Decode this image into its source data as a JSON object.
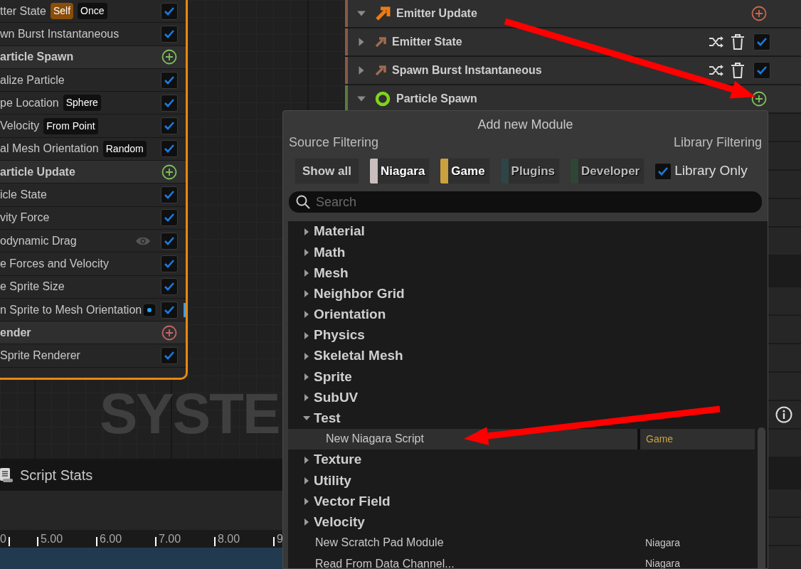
{
  "graph_node": {
    "rows": [
      {
        "kind": "module",
        "label": "tter State",
        "tags": [
          {
            "text": "Self",
            "kind": "accent"
          },
          {
            "text": "Once",
            "kind": "plain"
          }
        ],
        "checked": true
      },
      {
        "kind": "module",
        "label": "wn Burst Instantaneous",
        "checked": true
      },
      {
        "kind": "section",
        "label": "article Spawn",
        "color": "#7fbf5a"
      },
      {
        "kind": "module",
        "label": "alize Particle",
        "checked": true
      },
      {
        "kind": "module",
        "label": "pe Location",
        "tags": [
          {
            "text": "Sphere",
            "kind": "plain"
          }
        ],
        "checked": true
      },
      {
        "kind": "module",
        "label": "Velocity",
        "tags": [
          {
            "text": "From Point",
            "kind": "plain"
          }
        ],
        "checked": true
      },
      {
        "kind": "module",
        "label": "al Mesh Orientation",
        "tags": [
          {
            "text": "Random",
            "kind": "plain"
          }
        ],
        "checked": true
      },
      {
        "kind": "section",
        "label": "article Update",
        "color": "#7fbf5a"
      },
      {
        "kind": "module",
        "label": "icle State",
        "checked": true
      },
      {
        "kind": "module",
        "label": "vity Force",
        "checked": true
      },
      {
        "kind": "module",
        "label": "odynamic Drag",
        "debug_draw": true,
        "checked": true
      },
      {
        "kind": "module",
        "label": "e Forces and Velocity",
        "checked": true
      },
      {
        "kind": "module",
        "label": "e Sprite Size",
        "checked": true
      },
      {
        "kind": "module",
        "label": "n Sprite to Mesh Orientation",
        "linked": true,
        "highlighted": true,
        "checked": true
      },
      {
        "kind": "section",
        "label": "ender",
        "color": "#c86464"
      },
      {
        "kind": "module",
        "label": "Sprite Renderer",
        "checked": true
      }
    ]
  },
  "graph_label": "SYSTE",
  "script_stats": {
    "title": "Script Stats"
  },
  "timeline": {
    "ticks": [
      "0",
      "5.00",
      "6.00",
      "7.00",
      "8.00",
      "9"
    ]
  },
  "emitter_stack": {
    "rows": [
      {
        "kind": "emitter_stage",
        "label": "Emitter Update",
        "expanded": true,
        "color": "#8a5a44"
      },
      {
        "kind": "module",
        "label": "Emitter State",
        "expanded": false,
        "checked": true,
        "color": "#8a5a44"
      },
      {
        "kind": "module",
        "label": "Spawn Burst Instantaneous",
        "expanded": false,
        "checked": true,
        "color": "#8a5a44"
      },
      {
        "kind": "particle_stage",
        "label": "Particle Spawn",
        "expanded": true,
        "color": "#5e7a3e"
      }
    ]
  },
  "add_module_menu": {
    "title": "Add new Module",
    "source_label": "Source Filtering",
    "library_label": "Library Filtering",
    "sources": [
      {
        "label": "Show all",
        "kind": "all"
      },
      {
        "label": "Niagara",
        "kind": "source",
        "color": "#c9bfbf"
      },
      {
        "label": "Game",
        "kind": "source",
        "color": "#c9a13f"
      },
      {
        "label": "Plugins",
        "kind": "source",
        "color": "#2f4545"
      },
      {
        "label": "Developer",
        "kind": "source",
        "color": "#2f4535"
      }
    ],
    "library_only": {
      "label": "Library Only",
      "checked": true
    },
    "search": {
      "placeholder": "Search"
    },
    "tree": [
      {
        "kind": "category",
        "label": "Material",
        "expanded": false
      },
      {
        "kind": "category",
        "label": "Math",
        "expanded": false
      },
      {
        "kind": "category",
        "label": "Mesh",
        "expanded": false
      },
      {
        "kind": "category",
        "label": "Neighbor Grid",
        "expanded": false
      },
      {
        "kind": "category",
        "label": "Orientation",
        "expanded": false
      },
      {
        "kind": "category",
        "label": "Physics",
        "expanded": false
      },
      {
        "kind": "category",
        "label": "Skeletal Mesh",
        "expanded": false
      },
      {
        "kind": "category",
        "label": "Sprite",
        "expanded": false
      },
      {
        "kind": "category",
        "label": "SubUV",
        "expanded": false
      },
      {
        "kind": "category",
        "label": "Test",
        "expanded": true,
        "children": [
          {
            "kind": "module",
            "label": "New Niagara Script",
            "source": "Game",
            "color": "#c9a13f",
            "selected": true
          }
        ]
      },
      {
        "kind": "category",
        "label": "Texture",
        "expanded": false
      },
      {
        "kind": "category",
        "label": "Utility",
        "expanded": false
      },
      {
        "kind": "category",
        "label": "Vector Field",
        "expanded": false
      },
      {
        "kind": "category",
        "label": "Velocity",
        "expanded": false
      },
      {
        "kind": "module",
        "label": "New Scratch Pad Module",
        "source": "Niagara",
        "color": "#c8c8c8",
        "selected": false
      },
      {
        "kind": "module",
        "label": "Read From Data Channel...",
        "source": "Niagara",
        "color": "#c8c8c8",
        "selected": false
      }
    ]
  }
}
